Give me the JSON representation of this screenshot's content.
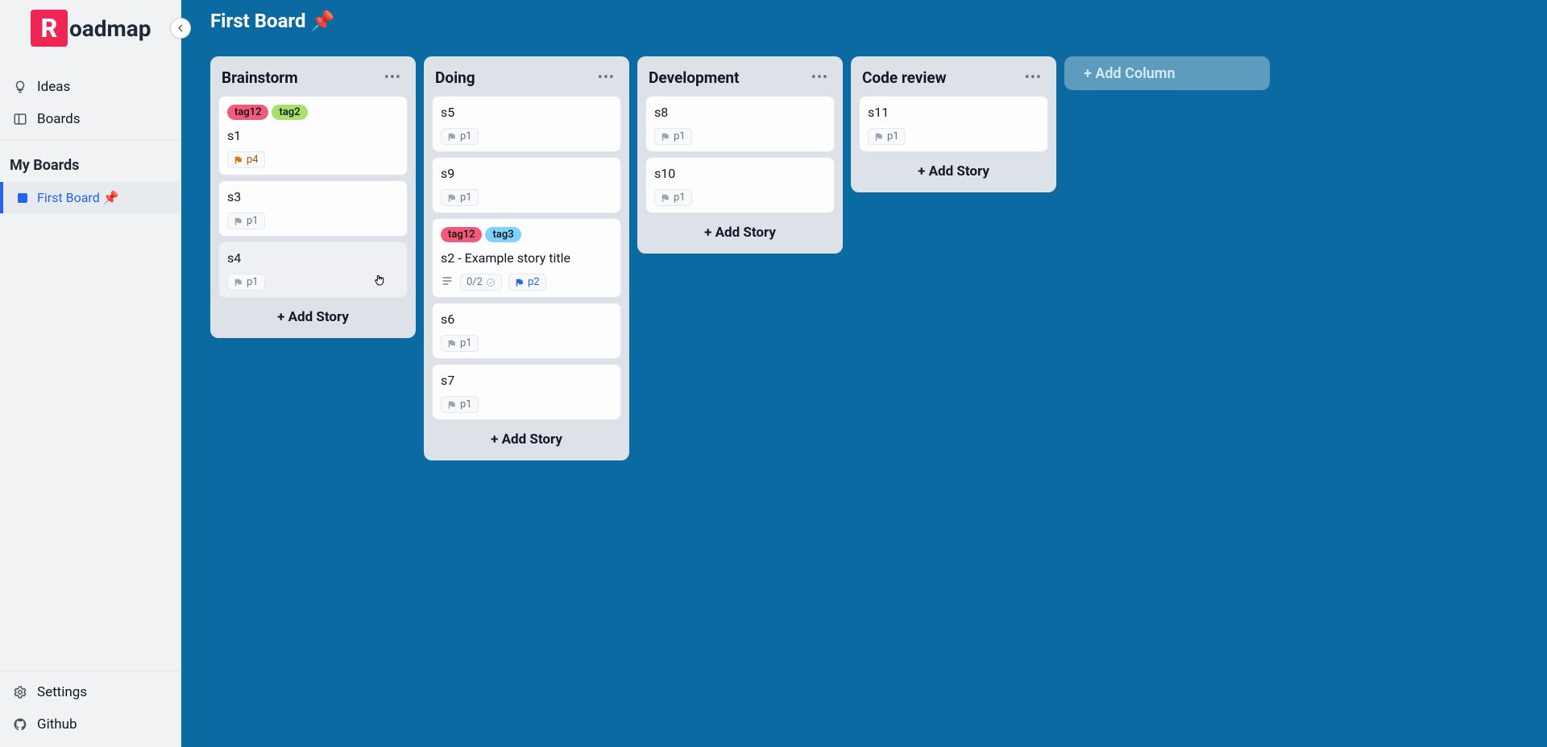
{
  "app": {
    "logo_letter": "R",
    "logo_rest": "oadmap"
  },
  "sidebar": {
    "nav": [
      {
        "id": "ideas",
        "label": "Ideas",
        "icon": "lightbulb-icon"
      },
      {
        "id": "boards",
        "label": "Boards",
        "icon": "boards-icon"
      }
    ],
    "my_boards_title": "My Boards",
    "boards": [
      {
        "id": "first-board",
        "label": "First Board 📌",
        "active": true
      }
    ],
    "bottom": [
      {
        "id": "settings",
        "label": "Settings",
        "icon": "gear-icon"
      },
      {
        "id": "github",
        "label": "Github",
        "icon": "github-icon"
      }
    ]
  },
  "board": {
    "title": "First Board 📌",
    "add_column_label": "+ Add Column",
    "add_story_label": "+ Add Story",
    "columns": [
      {
        "id": "brainstorm",
        "title": "Brainstorm",
        "cards": [
          {
            "id": "s1",
            "title": "s1",
            "tags": [
              {
                "text": "tag12",
                "color": "#f15a7a"
              },
              {
                "text": "tag2",
                "color": "#a7e16b"
              }
            ],
            "priority": "p4",
            "hover": false
          },
          {
            "id": "s3",
            "title": "s3",
            "tags": [],
            "priority": "p1",
            "hover": false
          },
          {
            "id": "s4",
            "title": "s4",
            "tags": [],
            "priority": "p1",
            "hover": true
          }
        ]
      },
      {
        "id": "doing",
        "title": "Doing",
        "cards": [
          {
            "id": "s5",
            "title": "s5",
            "tags": [],
            "priority": "p1",
            "hover": false
          },
          {
            "id": "s9",
            "title": "s9",
            "tags": [],
            "priority": "p1",
            "hover": false
          },
          {
            "id": "s2",
            "title": "s2 - Example story title",
            "tags": [
              {
                "text": "tag12",
                "color": "#f15a7a"
              },
              {
                "text": "tag3",
                "color": "#7dd3fc"
              }
            ],
            "priority": "p2",
            "has_description": true,
            "tasks": "0/2",
            "hover": false
          },
          {
            "id": "s6",
            "title": "s6",
            "tags": [],
            "priority": "p1",
            "hover": false
          },
          {
            "id": "s7",
            "title": "s7",
            "tags": [],
            "priority": "p1",
            "hover": false
          }
        ]
      },
      {
        "id": "development",
        "title": "Development",
        "cards": [
          {
            "id": "s8",
            "title": "s8",
            "tags": [],
            "priority": "p1",
            "hover": false
          },
          {
            "id": "s10",
            "title": "s10",
            "tags": [],
            "priority": "p1",
            "hover": false
          }
        ]
      },
      {
        "id": "code-review",
        "title": "Code review",
        "cards": [
          {
            "id": "s11",
            "title": "s11",
            "tags": [],
            "priority": "p1",
            "hover": false
          }
        ]
      }
    ]
  }
}
